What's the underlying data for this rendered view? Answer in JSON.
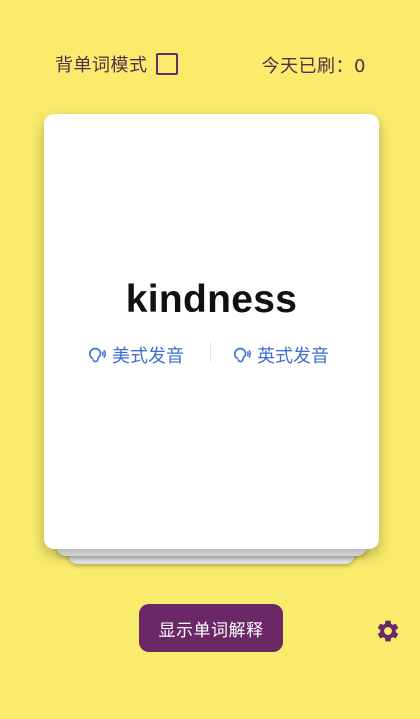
{
  "header": {
    "mode_label": "背单词模式",
    "mode_checked": false,
    "today_count": "今天已刷：0"
  },
  "card": {
    "word": "kindness",
    "pron_us": "美式发音",
    "pron_uk": "英式发音"
  },
  "footer": {
    "show_button_label": "显示单词解释"
  },
  "icons": {
    "speaker": "speaker-icon",
    "settings": "gear-icon"
  },
  "colors": {
    "background": "#f9ec6c",
    "accent": "#6b2867",
    "link": "#3f6fd0"
  }
}
